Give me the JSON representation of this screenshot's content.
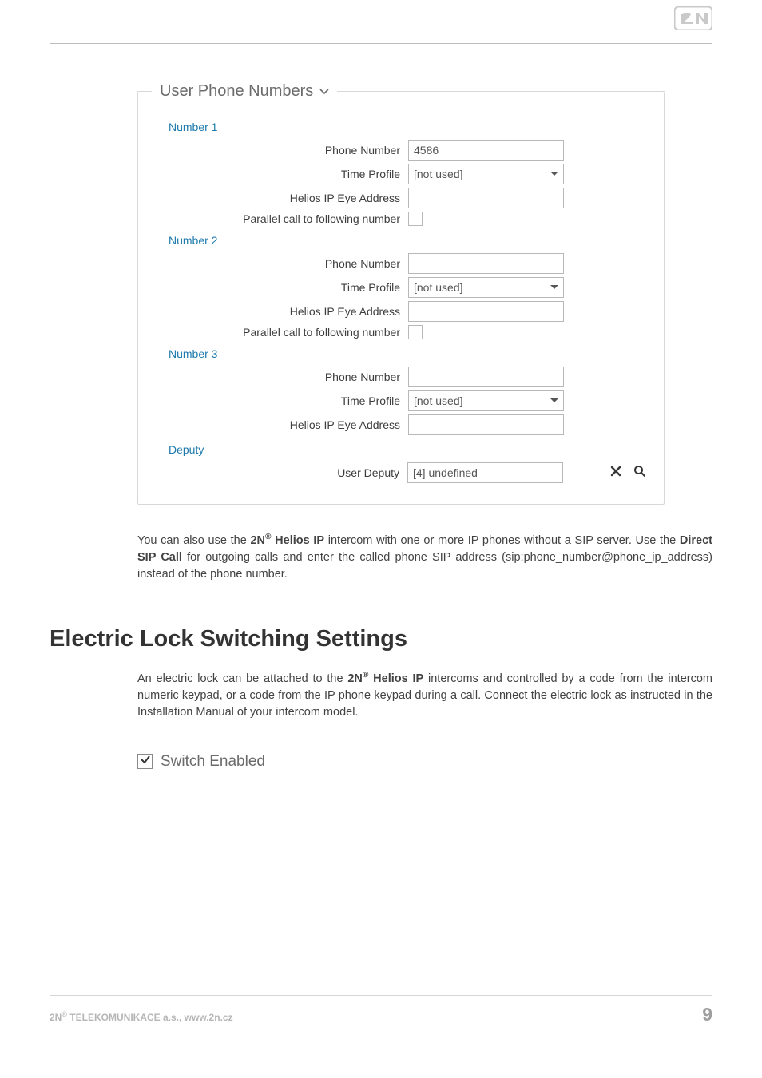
{
  "panel": {
    "title": "User Phone Numbers",
    "sections": {
      "number1": {
        "header": "Number 1",
        "phone_number_label": "Phone Number",
        "phone_number_value": "4586",
        "time_profile_label": "Time Profile",
        "time_profile_value": "[not used]",
        "helios_label": "Helios IP Eye Address",
        "helios_value": "",
        "parallel_label": "Parallel call to following number"
      },
      "number2": {
        "header": "Number 2",
        "phone_number_label": "Phone Number",
        "phone_number_value": "",
        "time_profile_label": "Time Profile",
        "time_profile_value": "[not used]",
        "helios_label": "Helios IP Eye Address",
        "helios_value": "",
        "parallel_label": "Parallel call to following number"
      },
      "number3": {
        "header": "Number 3",
        "phone_number_label": "Phone Number",
        "phone_number_value": "",
        "time_profile_label": "Time Profile",
        "time_profile_value": "[not used]",
        "helios_label": "Helios IP Eye Address",
        "helios_value": ""
      },
      "deputy": {
        "header": "Deputy",
        "user_deputy_label": "User Deputy",
        "user_deputy_value": "[4] undefined"
      }
    }
  },
  "paragraph1_parts": {
    "p1": "You can also use the ",
    "p2": "2N",
    "p3": " Helios IP",
    "p4": " intercom with one or more IP phones without a SIP server. Use the ",
    "p5": "Direct SIP Call",
    "p6": " for outgoing calls and enter the called phone SIP address (sip:phone_number@phone_ip_address) instead of the phone number."
  },
  "heading": "Electric Lock Switching Settings",
  "paragraph2_parts": {
    "p1": "An electric lock can be attached to the ",
    "p2": "2N",
    "p3": " Helios IP",
    "p4": " intercoms and controlled by a code from the intercom numeric keypad, or a code from the IP phone keypad during a call. Connect the electric lock as instructed in the Installation Manual of your intercom model."
  },
  "switch": {
    "label": "Switch Enabled"
  },
  "footer": {
    "left_prefix": "2N",
    "left_rest": " TELEKOMUNIKACE a.s., www.2n.cz",
    "page": "9"
  }
}
